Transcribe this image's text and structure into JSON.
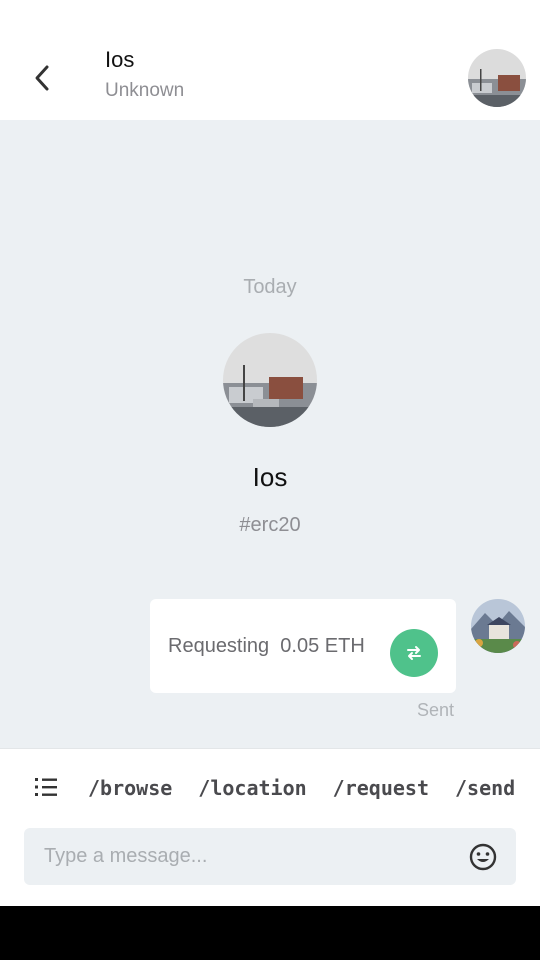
{
  "header": {
    "title": "Ios",
    "subtitle": "Unknown"
  },
  "chat": {
    "date_label": "Today",
    "contact_name": "Ios",
    "contact_tag": "#erc20",
    "message": {
      "text": "Requesting  0.05 ETH",
      "status": "Sent",
      "action_icon": "swap-arrows-icon",
      "action_color": "#4fc28b"
    }
  },
  "commands": [
    "/browse",
    "/location",
    "/request",
    "/send"
  ],
  "composer": {
    "placeholder": "Type a message..."
  },
  "icons": {
    "back": "chevron-left-icon",
    "menu": "list-icon",
    "emoji": "smiley-icon"
  }
}
